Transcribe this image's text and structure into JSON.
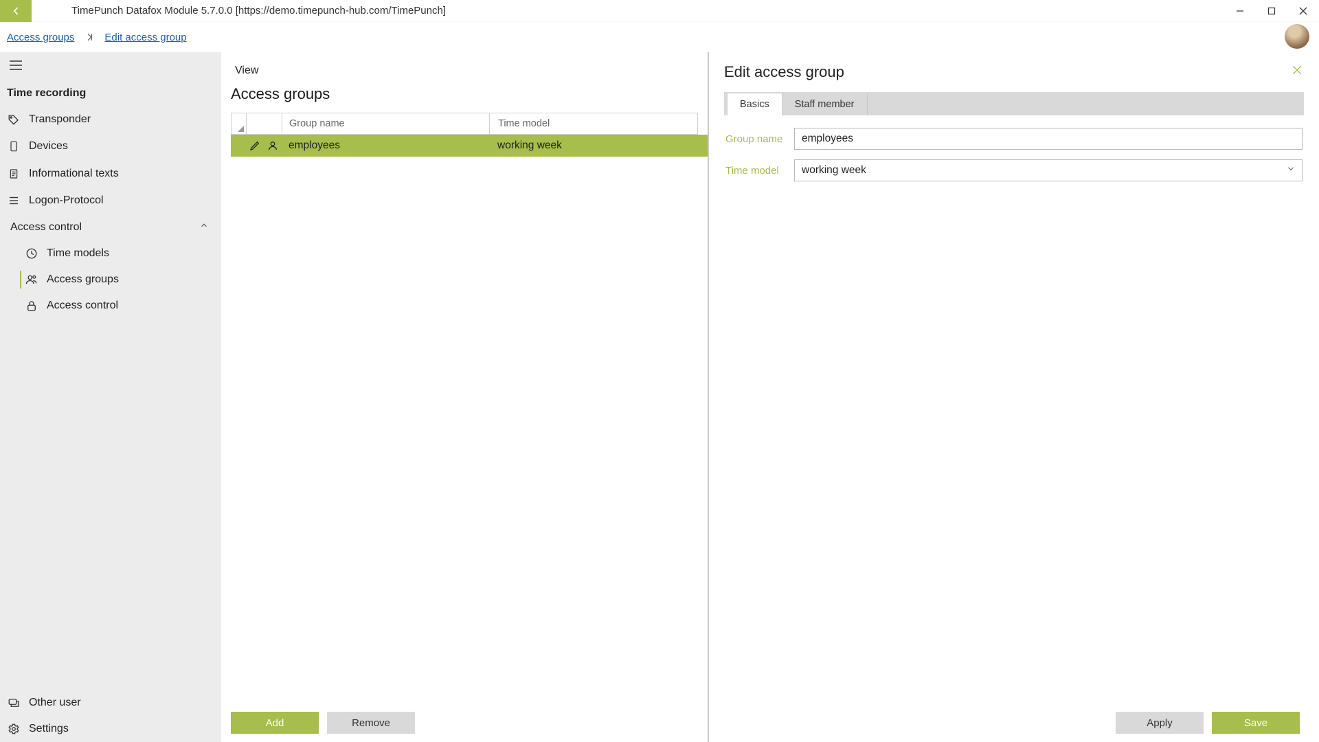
{
  "titlebar": {
    "title": "TimePunch Datafox Module 5.7.0.0 [https://demo.timepunch-hub.com/TimePunch]"
  },
  "breadcrumb": {
    "root": "Access groups",
    "leaf": "Edit access group"
  },
  "sidebar": {
    "section": "Time recording",
    "items": {
      "transponder": "Transponder",
      "devices": "Devices",
      "info_texts": "Informational texts",
      "logon_protocol": "Logon-Protocol"
    },
    "access_control": {
      "label": "Access control",
      "time_models": "Time models",
      "access_groups": "Access groups",
      "access_control": "Access control"
    },
    "bottom": {
      "other_user": "Other user",
      "settings": "Settings"
    }
  },
  "list": {
    "view_label": "View",
    "title": "Access groups",
    "col_group": "Group name",
    "col_time": "Time model",
    "row": {
      "group": "employees",
      "time": "working week"
    },
    "add": "Add",
    "remove": "Remove"
  },
  "detail": {
    "title": "Edit access group",
    "tab_basics": "Basics",
    "tab_staff": "Staff member",
    "label_group": "Group name",
    "label_time": "Time model",
    "value_group": "employees",
    "value_time": "working week",
    "apply": "Apply",
    "save": "Save"
  }
}
